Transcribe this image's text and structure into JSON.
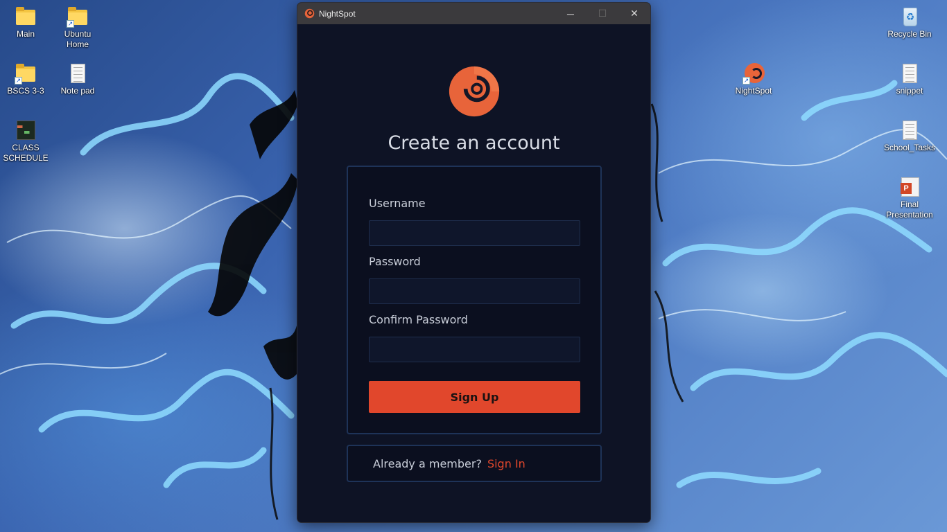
{
  "desktop": {
    "icons_left": [
      {
        "label": "Main"
      },
      {
        "label": "Ubuntu Home"
      },
      {
        "label": "BSCS 3-3"
      },
      {
        "label": "Note pad"
      },
      {
        "label": "CLASS SCHEDULE"
      }
    ],
    "icons_right": [
      {
        "label": "NightSpot"
      },
      {
        "label": "Recycle Bin"
      },
      {
        "label": "snippet"
      },
      {
        "label": "School_Tasks"
      },
      {
        "label": "Final Presentation"
      }
    ]
  },
  "window": {
    "title": "NightSpot",
    "controls": {
      "minimize": "─",
      "maximize": "☐",
      "close": "✕"
    }
  },
  "form": {
    "heading": "Create an account",
    "username_label": "Username",
    "username_value": "",
    "password_label": "Password",
    "password_value": "",
    "confirm_label": "Confirm Password",
    "confirm_value": "",
    "submit_label": "Sign Up"
  },
  "footer": {
    "prompt": "Already a member?",
    "link": "Sign In"
  },
  "colors": {
    "accent": "#e1472c",
    "logo": "#e8643a",
    "window_bg": "#0e1325",
    "card_border": "#1e3358",
    "titlebar": "#3b3a3d"
  },
  "icons": {
    "app_logo": "nightspot-logo-icon",
    "folder": "folder-icon",
    "document": "document-icon",
    "recycle": "recycle-bin-icon",
    "powerpoint": "powerpoint-icon"
  }
}
